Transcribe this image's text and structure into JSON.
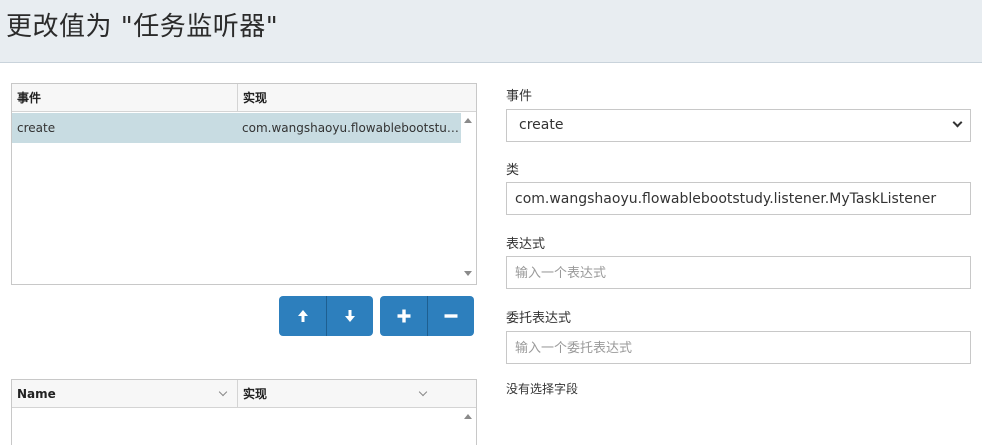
{
  "header": {
    "title": "更改值为 \"任务监听器\""
  },
  "listeners_grid": {
    "columns": [
      "事件",
      "实现"
    ],
    "rows": [
      {
        "event": "create",
        "implementation": "com.wangshaoyu.flowablebootstudy.listener.MyTaskListener",
        "selected": true
      }
    ]
  },
  "toolbar": {
    "buttons": [
      {
        "name": "move-up",
        "icon": "arrow-up-icon"
      },
      {
        "name": "move-down",
        "icon": "arrow-down-icon"
      },
      {
        "name": "add",
        "icon": "plus-icon"
      },
      {
        "name": "remove",
        "icon": "minus-icon"
      }
    ],
    "accent_color": "#2d7fbd"
  },
  "fields_grid": {
    "columns": [
      "Name",
      "实现"
    ]
  },
  "form": {
    "event_label": "事件",
    "event_value": "create",
    "class_label": "类",
    "class_value": "com.wangshaoyu.flowablebootstudy.listener.MyTaskListener",
    "expression_label": "表达式",
    "expression_placeholder": "输入一个表达式",
    "delegate_label": "委托表达式",
    "delegate_placeholder": "输入一个委托表达式",
    "no_field_text": "没有选择字段"
  }
}
